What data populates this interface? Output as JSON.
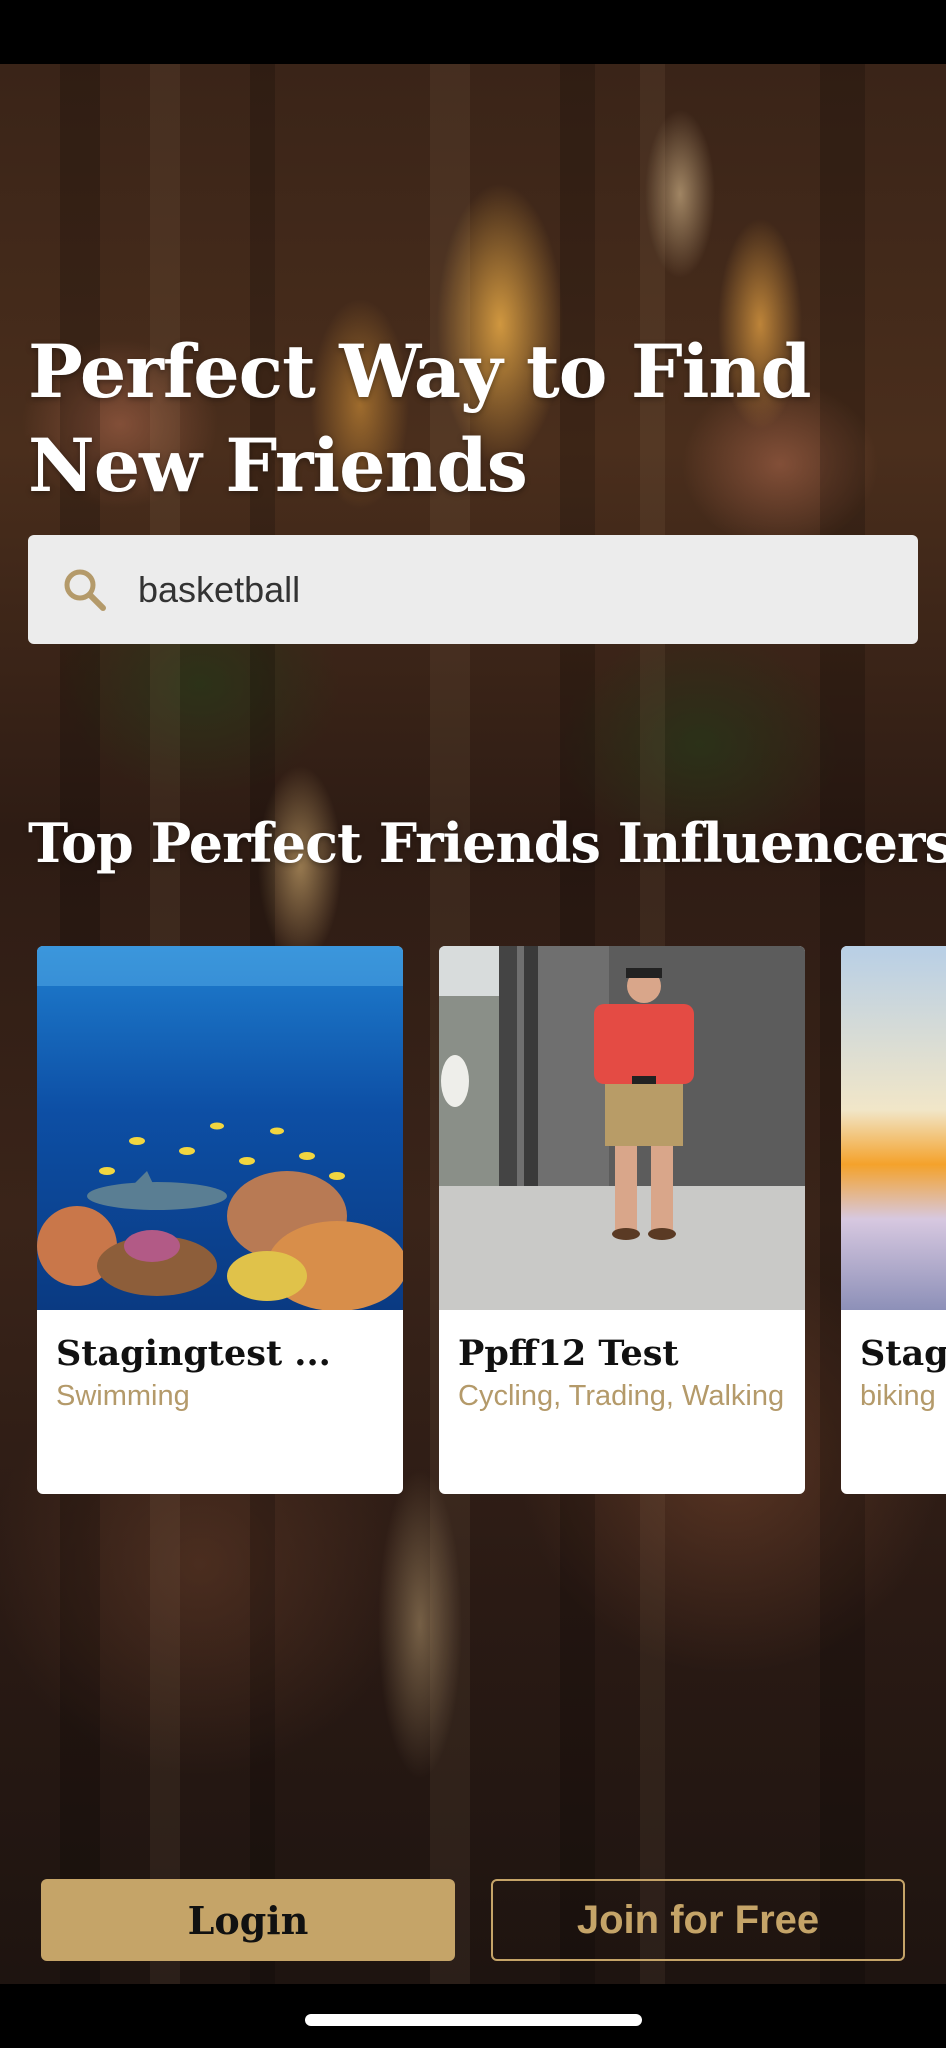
{
  "hero": {
    "headline_line1": "Perfect Way to Find",
    "headline_line2": "New Friends"
  },
  "search": {
    "icon": "search-icon",
    "value": "basketball"
  },
  "influencers": {
    "title": "Top Perfect Friends Influencers",
    "cards": [
      {
        "name": "Stagingtest ...",
        "interests": "Swimming",
        "image": "underwater-reef-photo"
      },
      {
        "name": "Ppff12 Test",
        "interests": "Cycling, Trading, Walking",
        "image": "man-at-zoo-photo"
      },
      {
        "name": "Stagi",
        "interests": "biking",
        "image": "sunset-sea-photo"
      }
    ]
  },
  "actions": {
    "login_label": "Login",
    "join_label": "Join for Free"
  },
  "colors": {
    "accent": "#c5a468",
    "interest_text": "#b49a6a",
    "search_bg": "#ececec"
  }
}
